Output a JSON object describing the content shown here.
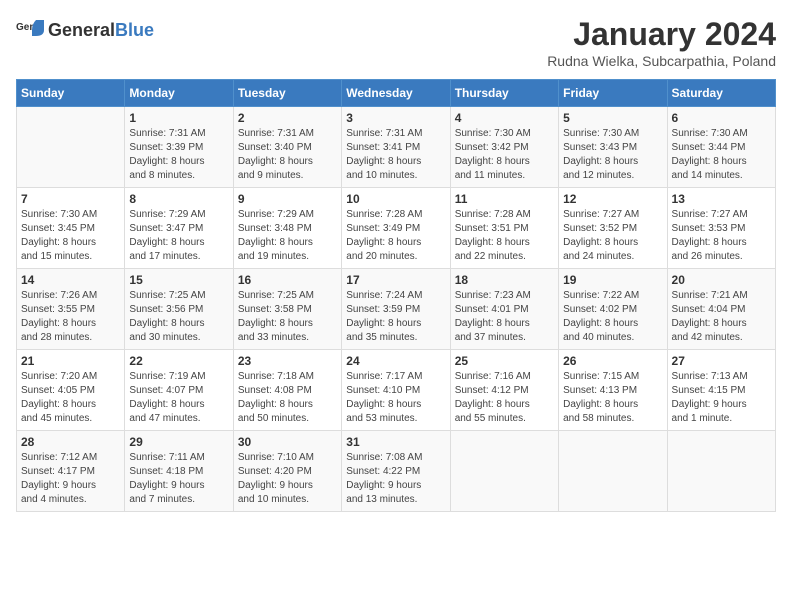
{
  "header": {
    "logo_general": "General",
    "logo_blue": "Blue",
    "title": "January 2024",
    "subtitle": "Rudna Wielka, Subcarpathia, Poland"
  },
  "days_of_week": [
    "Sunday",
    "Monday",
    "Tuesday",
    "Wednesday",
    "Thursday",
    "Friday",
    "Saturday"
  ],
  "weeks": [
    [
      {
        "day": "",
        "content": ""
      },
      {
        "day": "1",
        "content": "Sunrise: 7:31 AM\nSunset: 3:39 PM\nDaylight: 8 hours\nand 8 minutes."
      },
      {
        "day": "2",
        "content": "Sunrise: 7:31 AM\nSunset: 3:40 PM\nDaylight: 8 hours\nand 9 minutes."
      },
      {
        "day": "3",
        "content": "Sunrise: 7:31 AM\nSunset: 3:41 PM\nDaylight: 8 hours\nand 10 minutes."
      },
      {
        "day": "4",
        "content": "Sunrise: 7:30 AM\nSunset: 3:42 PM\nDaylight: 8 hours\nand 11 minutes."
      },
      {
        "day": "5",
        "content": "Sunrise: 7:30 AM\nSunset: 3:43 PM\nDaylight: 8 hours\nand 12 minutes."
      },
      {
        "day": "6",
        "content": "Sunrise: 7:30 AM\nSunset: 3:44 PM\nDaylight: 8 hours\nand 14 minutes."
      }
    ],
    [
      {
        "day": "7",
        "content": "Sunrise: 7:30 AM\nSunset: 3:45 PM\nDaylight: 8 hours\nand 15 minutes."
      },
      {
        "day": "8",
        "content": "Sunrise: 7:29 AM\nSunset: 3:47 PM\nDaylight: 8 hours\nand 17 minutes."
      },
      {
        "day": "9",
        "content": "Sunrise: 7:29 AM\nSunset: 3:48 PM\nDaylight: 8 hours\nand 19 minutes."
      },
      {
        "day": "10",
        "content": "Sunrise: 7:28 AM\nSunset: 3:49 PM\nDaylight: 8 hours\nand 20 minutes."
      },
      {
        "day": "11",
        "content": "Sunrise: 7:28 AM\nSunset: 3:51 PM\nDaylight: 8 hours\nand 22 minutes."
      },
      {
        "day": "12",
        "content": "Sunrise: 7:27 AM\nSunset: 3:52 PM\nDaylight: 8 hours\nand 24 minutes."
      },
      {
        "day": "13",
        "content": "Sunrise: 7:27 AM\nSunset: 3:53 PM\nDaylight: 8 hours\nand 26 minutes."
      }
    ],
    [
      {
        "day": "14",
        "content": "Sunrise: 7:26 AM\nSunset: 3:55 PM\nDaylight: 8 hours\nand 28 minutes."
      },
      {
        "day": "15",
        "content": "Sunrise: 7:25 AM\nSunset: 3:56 PM\nDaylight: 8 hours\nand 30 minutes."
      },
      {
        "day": "16",
        "content": "Sunrise: 7:25 AM\nSunset: 3:58 PM\nDaylight: 8 hours\nand 33 minutes."
      },
      {
        "day": "17",
        "content": "Sunrise: 7:24 AM\nSunset: 3:59 PM\nDaylight: 8 hours\nand 35 minutes."
      },
      {
        "day": "18",
        "content": "Sunrise: 7:23 AM\nSunset: 4:01 PM\nDaylight: 8 hours\nand 37 minutes."
      },
      {
        "day": "19",
        "content": "Sunrise: 7:22 AM\nSunset: 4:02 PM\nDaylight: 8 hours\nand 40 minutes."
      },
      {
        "day": "20",
        "content": "Sunrise: 7:21 AM\nSunset: 4:04 PM\nDaylight: 8 hours\nand 42 minutes."
      }
    ],
    [
      {
        "day": "21",
        "content": "Sunrise: 7:20 AM\nSunset: 4:05 PM\nDaylight: 8 hours\nand 45 minutes."
      },
      {
        "day": "22",
        "content": "Sunrise: 7:19 AM\nSunset: 4:07 PM\nDaylight: 8 hours\nand 47 minutes."
      },
      {
        "day": "23",
        "content": "Sunrise: 7:18 AM\nSunset: 4:08 PM\nDaylight: 8 hours\nand 50 minutes."
      },
      {
        "day": "24",
        "content": "Sunrise: 7:17 AM\nSunset: 4:10 PM\nDaylight: 8 hours\nand 53 minutes."
      },
      {
        "day": "25",
        "content": "Sunrise: 7:16 AM\nSunset: 4:12 PM\nDaylight: 8 hours\nand 55 minutes."
      },
      {
        "day": "26",
        "content": "Sunrise: 7:15 AM\nSunset: 4:13 PM\nDaylight: 8 hours\nand 58 minutes."
      },
      {
        "day": "27",
        "content": "Sunrise: 7:13 AM\nSunset: 4:15 PM\nDaylight: 9 hours\nand 1 minute."
      }
    ],
    [
      {
        "day": "28",
        "content": "Sunrise: 7:12 AM\nSunset: 4:17 PM\nDaylight: 9 hours\nand 4 minutes."
      },
      {
        "day": "29",
        "content": "Sunrise: 7:11 AM\nSunset: 4:18 PM\nDaylight: 9 hours\nand 7 minutes."
      },
      {
        "day": "30",
        "content": "Sunrise: 7:10 AM\nSunset: 4:20 PM\nDaylight: 9 hours\nand 10 minutes."
      },
      {
        "day": "31",
        "content": "Sunrise: 7:08 AM\nSunset: 4:22 PM\nDaylight: 9 hours\nand 13 minutes."
      },
      {
        "day": "",
        "content": ""
      },
      {
        "day": "",
        "content": ""
      },
      {
        "day": "",
        "content": ""
      }
    ]
  ]
}
